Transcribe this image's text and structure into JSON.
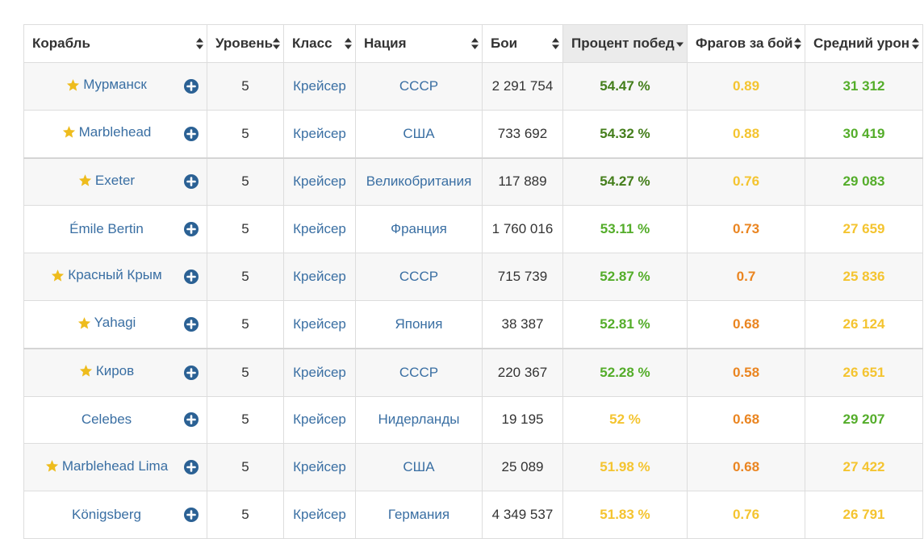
{
  "table": {
    "headers": [
      {
        "label": "Корабль",
        "sort": "both"
      },
      {
        "label": "Уровень",
        "sort": "both"
      },
      {
        "label": "Класс",
        "sort": "both"
      },
      {
        "label": "Нация",
        "sort": "both"
      },
      {
        "label": "Бои",
        "sort": "both"
      },
      {
        "label": "Процент побед",
        "sort": "desc",
        "active": true
      },
      {
        "label": "Фрагов за бой",
        "sort": "both"
      },
      {
        "label": "Средний урон",
        "sort": "both"
      }
    ],
    "colors": {
      "dark_green": "#447e1b",
      "green": "#54ad2a",
      "yellow": "#f4c430",
      "orange": "#ea8521",
      "link": "#3a6fa3",
      "star": "#eebc1d",
      "plus": "#2b6194"
    },
    "rows": [
      {
        "ship": "Мурманск",
        "premium": true,
        "tier": "5",
        "class": "Крейсер",
        "nation": "СССР",
        "battles": "2 291 754",
        "winrate": "54.47 %",
        "winrate_color": "dark_green",
        "frags": "0.89",
        "frags_color": "yellow",
        "damage": "31 312",
        "damage_color": "green"
      },
      {
        "ship": "Marblehead",
        "premium": true,
        "tier": "5",
        "class": "Крейсер",
        "nation": "США",
        "battles": "733 692",
        "winrate": "54.32 %",
        "winrate_color": "dark_green",
        "frags": "0.88",
        "frags_color": "yellow",
        "damage": "30 419",
        "damage_color": "green"
      },
      {
        "ship": "Exeter",
        "premium": true,
        "tier": "5",
        "class": "Крейсер",
        "nation": "Великобритания",
        "battles": "117 889",
        "winrate": "54.27 %",
        "winrate_color": "dark_green",
        "frags": "0.76",
        "frags_color": "yellow",
        "damage": "29 083",
        "damage_color": "green"
      },
      {
        "ship": "Émile Bertin",
        "premium": false,
        "tier": "5",
        "class": "Крейсер",
        "nation": "Франция",
        "battles": "1 760 016",
        "winrate": "53.11 %",
        "winrate_color": "green",
        "frags": "0.73",
        "frags_color": "orange",
        "damage": "27 659",
        "damage_color": "yellow"
      },
      {
        "ship": "Красный Крым",
        "premium": true,
        "tier": "5",
        "class": "Крейсер",
        "nation": "СССР",
        "battles": "715 739",
        "winrate": "52.87 %",
        "winrate_color": "green",
        "frags": "0.7",
        "frags_color": "orange",
        "damage": "25 836",
        "damage_color": "yellow"
      },
      {
        "ship": "Yahagi",
        "premium": true,
        "tier": "5",
        "class": "Крейсер",
        "nation": "Япония",
        "battles": "38 387",
        "winrate": "52.81 %",
        "winrate_color": "green",
        "frags": "0.68",
        "frags_color": "orange",
        "damage": "26 124",
        "damage_color": "yellow"
      },
      {
        "ship": "Киров",
        "premium": true,
        "tier": "5",
        "class": "Крейсер",
        "nation": "СССР",
        "battles": "220 367",
        "winrate": "52.28 %",
        "winrate_color": "green",
        "frags": "0.58",
        "frags_color": "orange",
        "damage": "26 651",
        "damage_color": "yellow"
      },
      {
        "ship": "Celebes",
        "premium": false,
        "tier": "5",
        "class": "Крейсер",
        "nation": "Нидерланды",
        "battles": "19 195",
        "winrate": "52 %",
        "winrate_color": "yellow",
        "frags": "0.68",
        "frags_color": "orange",
        "damage": "29 207",
        "damage_color": "green"
      },
      {
        "ship": "Marblehead Lima",
        "premium": true,
        "tier": "5",
        "class": "Крейсер",
        "nation": "США",
        "battles": "25 089",
        "winrate": "51.98 %",
        "winrate_color": "yellow",
        "frags": "0.68",
        "frags_color": "orange",
        "damage": "27 422",
        "damage_color": "yellow"
      },
      {
        "ship": "Königsberg",
        "premium": false,
        "tier": "5",
        "class": "Крейсер",
        "nation": "Германия",
        "battles": "4 349 537",
        "winrate": "51.83 %",
        "winrate_color": "yellow",
        "frags": "0.76",
        "frags_color": "yellow",
        "damage": "26 791",
        "damage_color": "yellow"
      }
    ]
  }
}
